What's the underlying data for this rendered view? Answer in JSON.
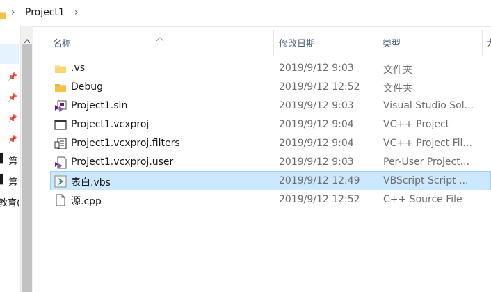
{
  "address": {
    "crumb": "Project1",
    "separator": "›"
  },
  "nav": {
    "items": [
      {
        "label": "第",
        "pinned": false
      },
      {
        "label": "第",
        "pinned": false
      },
      {
        "label": "教育(",
        "pinned": false
      }
    ]
  },
  "columns": {
    "name": "名称",
    "date": "修改日期",
    "type": "类型",
    "size": "大"
  },
  "files": [
    {
      "name": ".vs",
      "date": "2019/9/12 9:03",
      "type": "文件夹",
      "icon": "folder-icon"
    },
    {
      "name": "Debug",
      "date": "2019/9/12 12:52",
      "type": "文件夹",
      "icon": "folder-icon"
    },
    {
      "name": "Project1.sln",
      "date": "2019/9/12 9:03",
      "type": "Visual Studio Sol...",
      "icon": "vs-solution-icon"
    },
    {
      "name": "Project1.vcxproj",
      "date": "2019/9/12 9:04",
      "type": "VC++ Project",
      "icon": "vcxproj-icon"
    },
    {
      "name": "Project1.vcxproj.filters",
      "date": "2019/9/12 9:04",
      "type": "VC++ Project Fil...",
      "icon": "filters-icon"
    },
    {
      "name": "Project1.vcxproj.user",
      "date": "2019/9/12 9:03",
      "type": "Per-User Project...",
      "icon": "vs-user-icon"
    },
    {
      "name": "表白.vbs",
      "date": "2019/9/12 12:49",
      "type": "VBScript Script ...",
      "icon": "vbs-script-icon",
      "selected": true
    },
    {
      "name": "源.cpp",
      "date": "2019/9/12 12:52",
      "type": "C++ Source File",
      "icon": "blank-file-icon"
    }
  ],
  "colors": {
    "selection_bg": "#cce8ff",
    "selection_border": "#99d1ff",
    "folder": "#f4c246",
    "vs_purple": "#68217a"
  }
}
